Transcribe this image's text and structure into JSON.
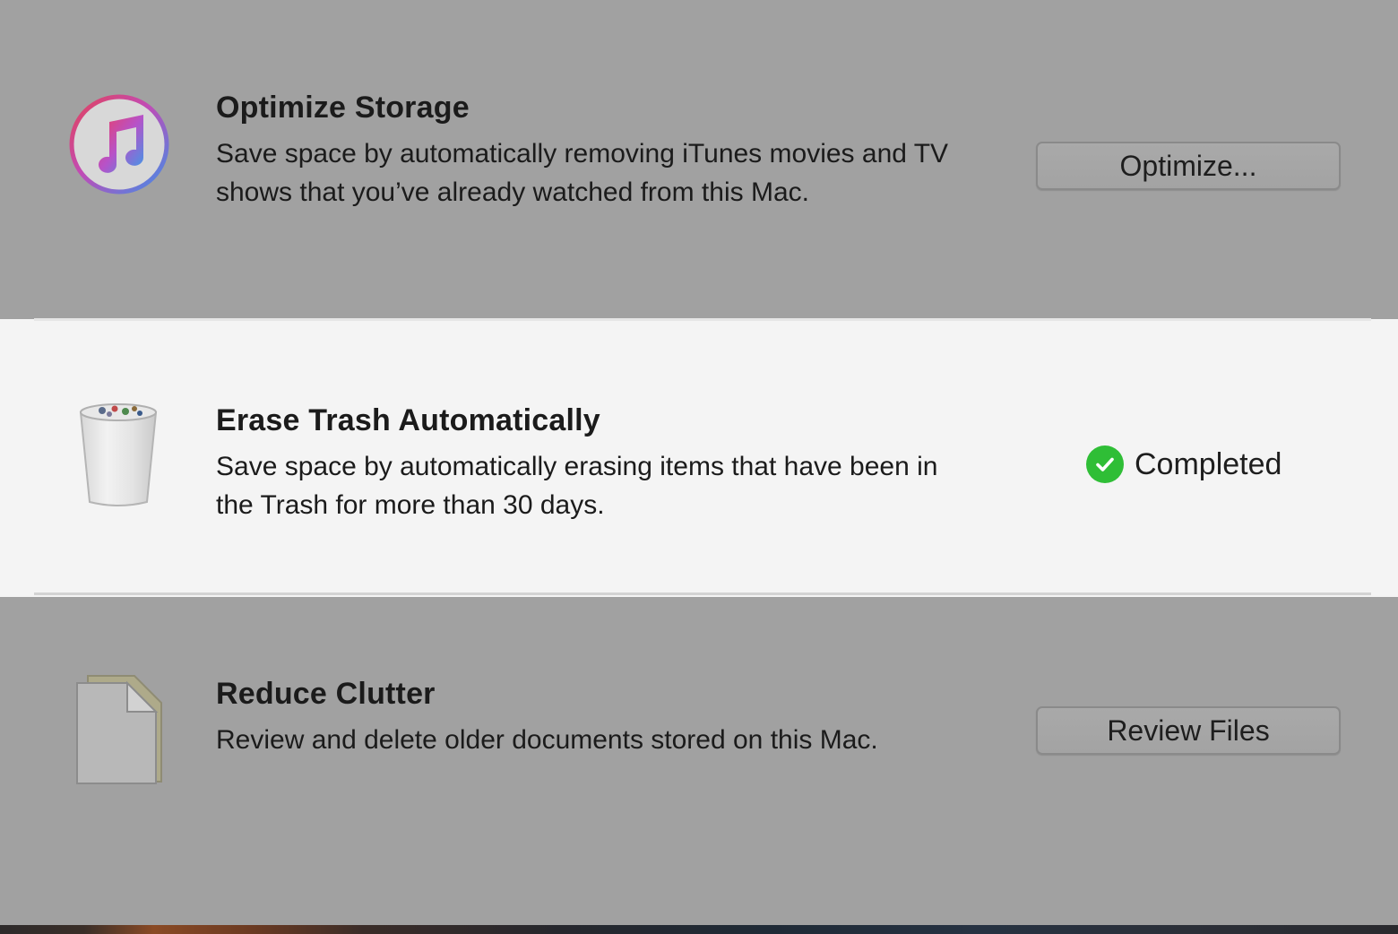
{
  "rows": [
    {
      "title": "Optimize Storage",
      "description": "Save space by automatically removing iTunes movies and TV shows that you’ve already watched from this Mac.",
      "icon": "itunes-icon",
      "button_label": "Optimize..."
    },
    {
      "title": "Erase Trash Automatically",
      "description": "Save space by automatically erasing items that have been in the Trash for more than 30 days.",
      "icon": "trash-icon",
      "status_label": "Completed",
      "status_icon": "checkmark-icon"
    },
    {
      "title": "Reduce Clutter",
      "description": "Review and delete older documents stored on this Mac.",
      "icon": "document-icon",
      "button_label": "Review Files"
    }
  ],
  "colors": {
    "inactive_row_background": "#a1a1a1",
    "highlighted_row_background": "#f4f4f4",
    "status_green": "#2fbe36"
  }
}
